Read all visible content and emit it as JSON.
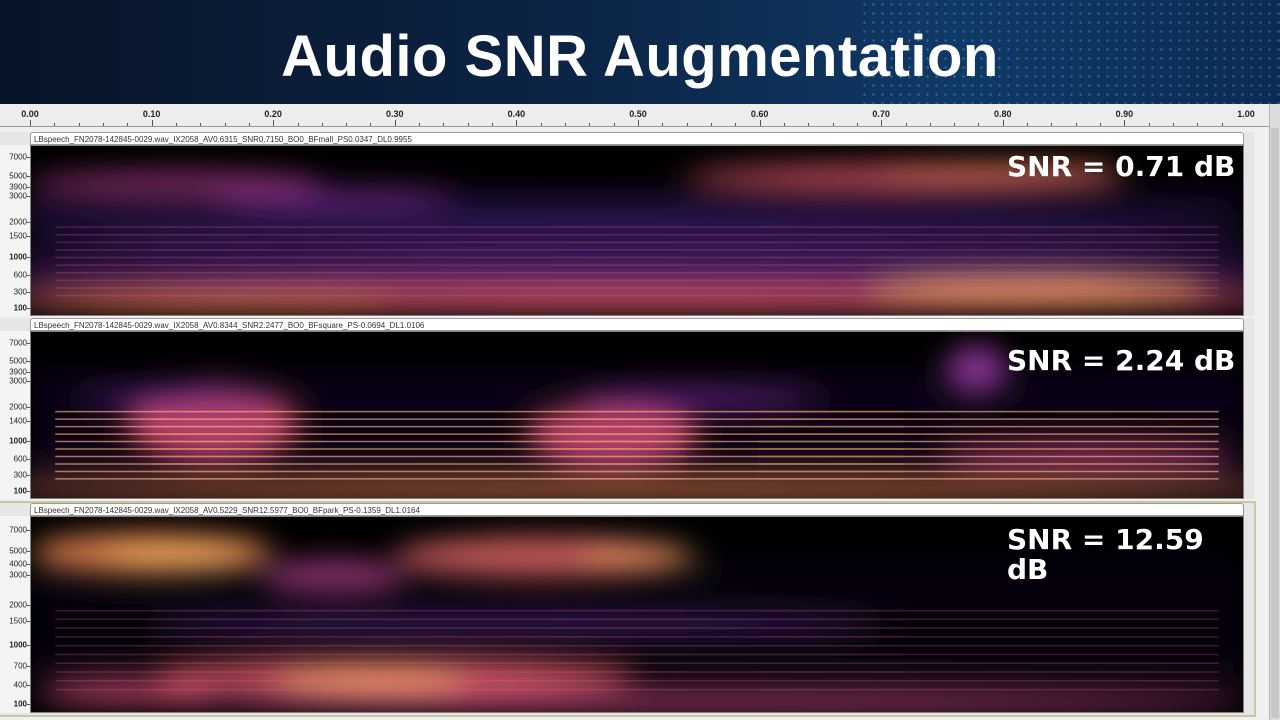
{
  "slide": {
    "title": "Audio SNR Augmentation"
  },
  "ruler": {
    "ticks": [
      "0.00",
      "0.10",
      "0.20",
      "0.30",
      "0.40",
      "0.50",
      "0.60",
      "0.70",
      "0.80",
      "0.90",
      "1.00"
    ]
  },
  "tracks": [
    {
      "filename": "LBspeech_FN2078-142845-0029.wav_IX2058_AV0.6315_SNR0.7150_BO0_BFmall_PS0.0347_DL0.9955",
      "snr_label": "SNR = 0.71 dB",
      "freq_labels": [
        "7000",
        "5000",
        "3900",
        "3000",
        "2000",
        "1500",
        "1000",
        "600",
        "300",
        "100"
      ]
    },
    {
      "filename": "LBspeech_FN2078-142845-0029.wav_IX2058_AV0.8344_SNR2.2477_BO0_BFsquare_PS-0.0694_DL1.0106",
      "snr_label": "SNR = 2.24 dB",
      "freq_labels": [
        "7000",
        "5000",
        "3900",
        "3000",
        "2000",
        "1400",
        "1000",
        "600",
        "300",
        "100"
      ]
    },
    {
      "filename": "LBspeech_FN2078-142845-0029.wav_IX2058_AV0.5229_SNR12.5977_BO0_BFpark_PS-0.1359_DL1.0164",
      "snr_label": "SNR = 12.59 dB",
      "freq_labels": [
        "7000",
        "5000",
        "4000",
        "3000",
        "2000",
        "1500",
        "1000",
        "700",
        "400",
        "100"
      ]
    }
  ],
  "colors": {
    "spec_bg": "#000000",
    "magma_mid": "#7b2fa8",
    "magma_hot": "#f06a3c",
    "magma_peak": "#fcd16b"
  }
}
